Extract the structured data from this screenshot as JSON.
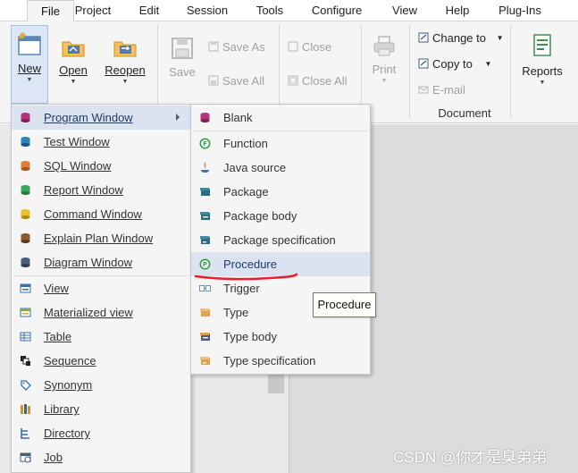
{
  "menubar": {
    "tabs": [
      "File",
      "Project",
      "Edit",
      "Session",
      "Tools",
      "Configure",
      "View",
      "Help",
      "Plug-Ins"
    ],
    "active": "File"
  },
  "ribbon": {
    "new": {
      "label": "New",
      "icon": "new-window-icon"
    },
    "open": {
      "label": "Open",
      "icon": "open-folder-icon"
    },
    "reopen": {
      "label": "Reopen",
      "icon": "reopen-folder-icon"
    },
    "save": {
      "label": "Save",
      "icon": "floppy-disk-icon"
    },
    "save_as": {
      "label": "Save As",
      "icon": "save-as-icon"
    },
    "save_all": {
      "label": "Save All",
      "icon": "save-all-icon"
    },
    "close": {
      "label": "Close",
      "icon": "close-window-icon"
    },
    "close_all": {
      "label": "Close All",
      "icon": "close-all-icon"
    },
    "print": {
      "label": "Print",
      "icon": "printer-icon"
    },
    "change_to": {
      "label": "Change to",
      "icon": "change-to-icon"
    },
    "copy_to": {
      "label": "Copy to",
      "icon": "copy-to-icon"
    },
    "email": {
      "label": "E-mail",
      "icon": "email-icon"
    },
    "reports": {
      "label": "Reports",
      "icon": "reports-icon"
    },
    "document_group": "Document"
  },
  "new_menu": {
    "items": [
      {
        "label": "Program Window",
        "icon": "program-window-icon",
        "color": "#b5357a",
        "submenu": true,
        "highlighted": true
      },
      {
        "label": "Test Window",
        "icon": "test-window-icon",
        "color": "#2f7fc1"
      },
      {
        "label": "SQL Window",
        "icon": "sql-window-icon",
        "color": "#e07b39"
      },
      {
        "label": "Report Window",
        "icon": "report-window-icon",
        "color": "#3ca65c"
      },
      {
        "label": "Command Window",
        "icon": "command-window-icon",
        "color": "#e6c12e"
      },
      {
        "label": "Explain Plan Window",
        "icon": "explain-plan-window-icon",
        "color": "#8a5a2b"
      },
      {
        "label": "Diagram Window",
        "icon": "diagram-window-icon",
        "color": "#4a5d7a"
      },
      {
        "label": "View",
        "icon": "view-icon",
        "color": "#3f6fa8"
      },
      {
        "label": "Materialized view",
        "icon": "materialized-view-icon",
        "color": "#8aa63c"
      },
      {
        "label": "Table",
        "icon": "table-icon",
        "color": "#3f6fa8"
      },
      {
        "label": "Sequence",
        "icon": "sequence-icon",
        "color": "#222222"
      },
      {
        "label": "Synonym",
        "icon": "synonym-icon",
        "color": "#2f6fb5"
      },
      {
        "label": "Library",
        "icon": "library-icon",
        "color": "#c8972f"
      },
      {
        "label": "Directory",
        "icon": "directory-icon",
        "color": "#2f6fb5"
      },
      {
        "label": "Job",
        "icon": "job-icon",
        "color": "#4a5d7a"
      }
    ]
  },
  "program_submenu": {
    "items": [
      {
        "label": "Blank",
        "icon": "blank-program-icon",
        "color": "#b5357a"
      },
      {
        "label": "Function",
        "icon": "function-icon",
        "color": "#2ea043"
      },
      {
        "label": "Java source",
        "icon": "java-source-icon",
        "color": "#e07b39"
      },
      {
        "label": "Package",
        "icon": "package-icon",
        "color": "#2c6e80"
      },
      {
        "label": "Package body",
        "icon": "package-body-icon",
        "color": "#2c6e80"
      },
      {
        "label": "Package specification",
        "icon": "package-specification-icon",
        "color": "#2c6e80"
      },
      {
        "label": "Procedure",
        "icon": "procedure-icon",
        "color": "#2ea043",
        "highlighted": true
      },
      {
        "label": "Trigger",
        "icon": "trigger-icon",
        "color": "#6a8fb8"
      },
      {
        "label": "Type",
        "icon": "type-icon",
        "color": "#e0a050"
      },
      {
        "label": "Type body",
        "icon": "type-body-icon",
        "color": "#4a5d7a"
      },
      {
        "label": "Type specification",
        "icon": "type-specification-icon",
        "color": "#e0a050"
      }
    ]
  },
  "tooltip": "Procedure",
  "watermark": "CSDN @你才是臭弟弟",
  "accent_colors": {
    "menu_highlight": "#dbe3f1",
    "annotation_red": "#e8202a"
  }
}
